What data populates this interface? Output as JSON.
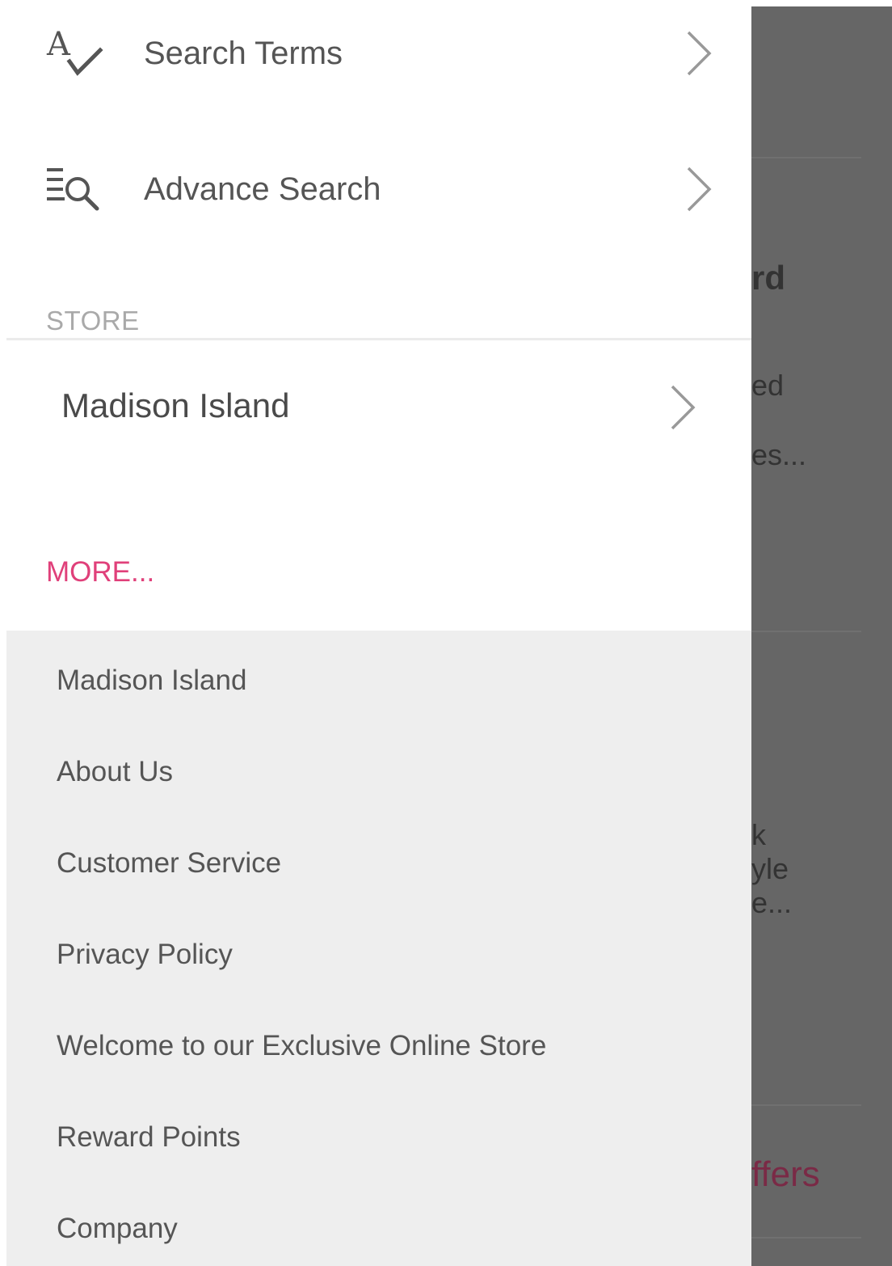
{
  "drawer": {
    "search_items": [
      {
        "label": "Search Terms",
        "icon": "spellcheck-icon"
      },
      {
        "label": "Advance Search",
        "icon": "advanced-search-icon"
      }
    ],
    "store_section": {
      "header": "STORE",
      "store_name": "Madison Island"
    },
    "more": {
      "link_label": "MORE...",
      "items": [
        "Madison Island",
        "About Us",
        "Customer Service",
        "Privacy Policy",
        "Welcome to our Exclusive Online Store",
        "Reward Points",
        "Company"
      ]
    }
  },
  "background_fragments": [
    "rd",
    "ed",
    "es...",
    "k",
    "yle",
    "e...",
    "ffers"
  ],
  "colors": {
    "accent_pink": "#e0407a",
    "more_list_bg": "#eeeeee",
    "overlay": "#666666",
    "text_primary": "#555555",
    "text_muted": "#a9a9a9"
  }
}
